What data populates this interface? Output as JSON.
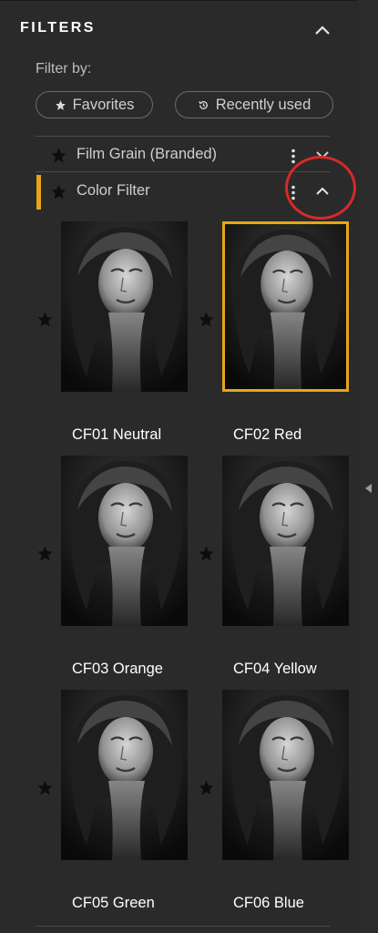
{
  "panel": {
    "title": "FILTERS",
    "filter_by": "Filter by:",
    "pills": {
      "favorites": "Favorites",
      "recently_used": "Recently used"
    },
    "groups": [
      {
        "label": "Film Grain (Branded)",
        "expanded": false
      },
      {
        "label": "Color Filter",
        "expanded": true
      }
    ],
    "presets": [
      {
        "name": "CF01 Neutral",
        "selected": false
      },
      {
        "name": "CF02 Red",
        "selected": true
      },
      {
        "name": "CF03 Orange",
        "selected": false
      },
      {
        "name": "CF04 Yellow",
        "selected": false
      },
      {
        "name": "CF05 Green",
        "selected": false
      },
      {
        "name": "CF06 Blue",
        "selected": false
      }
    ]
  },
  "colors": {
    "accent": "#e8a418",
    "highlight_circle": "#d42a2a",
    "background": "#2a2a2a"
  }
}
